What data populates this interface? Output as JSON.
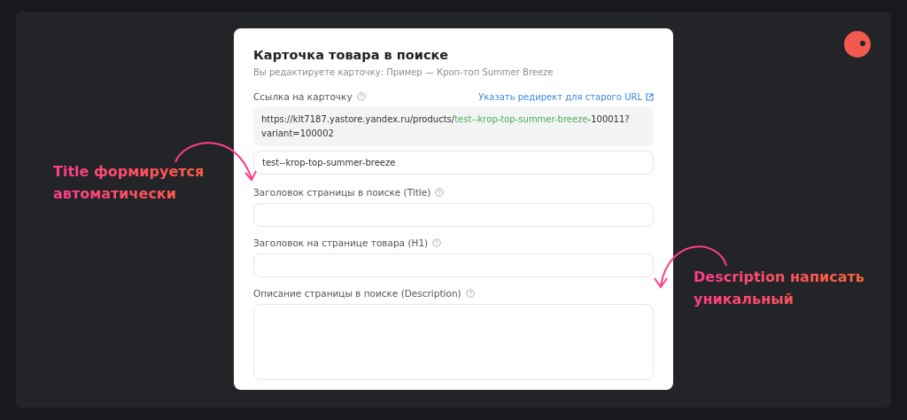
{
  "card": {
    "title": "Карточка товара в поиске",
    "subtitle": "Вы редактируете карточку: Пример — Кроп-топ Summer Breeze",
    "link": {
      "label": "Ссылка на карточку",
      "redirect_link": "Указать редирект для старого URL",
      "url_parts": [
        {
          "text": "https://klt7187.yastore.yandex.ru/products/",
          "highlight": false
        },
        {
          "text": "test--krop-top-summer-breeze",
          "highlight": true
        },
        {
          "text": "-100011?variant=100002",
          "highlight": false
        }
      ],
      "slug": "test--krop-top-summer-breeze"
    },
    "fields": [
      {
        "label": "Заголовок страницы в поиске (Title)",
        "kind": "input"
      },
      {
        "label": "Заголовок на странице товара (H1)",
        "kind": "input"
      },
      {
        "label": "Описание страницы в поиске (Description)",
        "kind": "textarea"
      }
    ]
  },
  "annotations": {
    "left_note": "Title формируется автоматически",
    "right_note": "Description написать уникальный"
  }
}
